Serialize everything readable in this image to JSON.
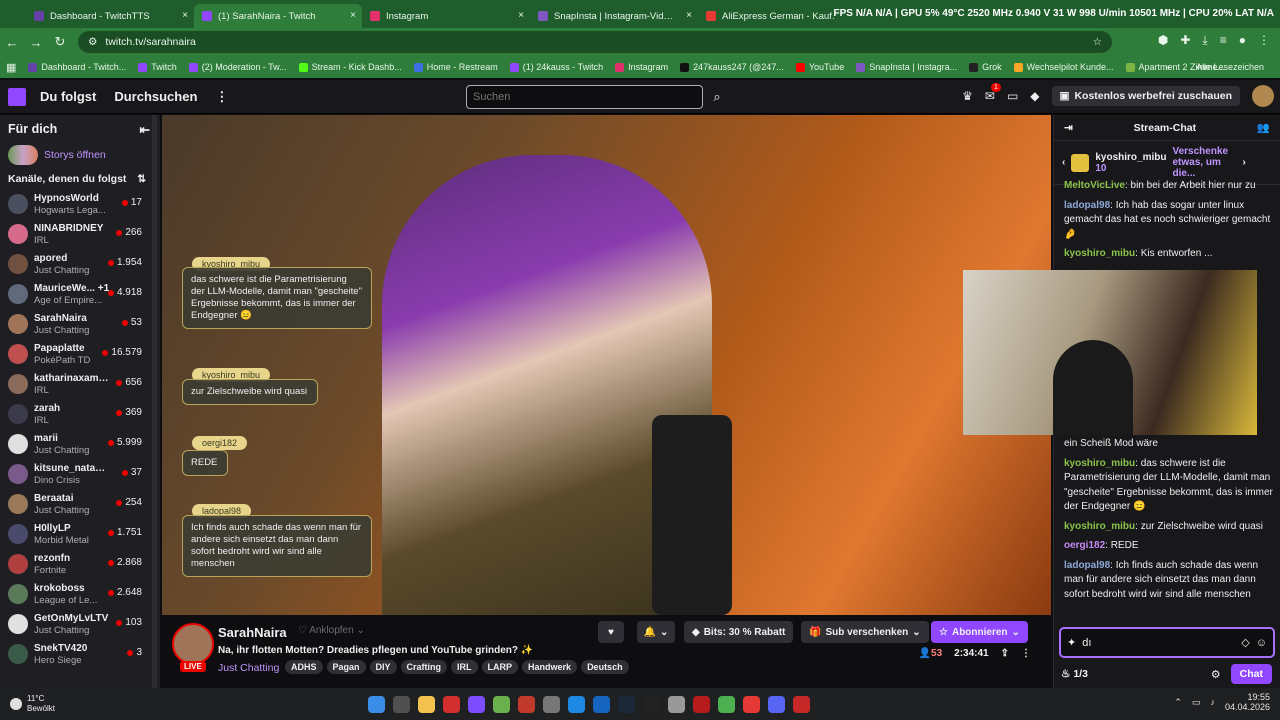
{
  "browser": {
    "tabs": [
      {
        "title": "Dashboard - TwitchTTS",
        "color": "#6441a5"
      },
      {
        "title": "(1) SarahNaira - Twitch",
        "color": "#9147ff"
      },
      {
        "title": "Instagram",
        "color": "#e1306c"
      },
      {
        "title": "SnapInsta | Instagram-Videos, F",
        "color": "#7e57c2"
      },
      {
        "title": "AliExpress German - Kaufen Si",
        "color": "#e53935"
      }
    ],
    "sysinfo": "FPS N/A N/A | GPU 5% 49°C 2520 MHz 0.940 V 31 W 998 U/min 10501 MHz | CPU 20% LAT N/A",
    "url": "twitch.tv/sarahnaira",
    "bookmarks": [
      {
        "label": "Dashboard - Twitch...",
        "color": "#6441a5"
      },
      {
        "label": "Twitch",
        "color": "#9147ff"
      },
      {
        "label": "(2) Moderation - Tw...",
        "color": "#9147ff"
      },
      {
        "label": "Stream - Kick Dashb...",
        "color": "#53fc18"
      },
      {
        "label": "Home - Restream",
        "color": "#3d6fe0"
      },
      {
        "label": "(1) 24kauss - Twitch",
        "color": "#9147ff"
      },
      {
        "label": "Instagram",
        "color": "#e1306c"
      },
      {
        "label": "247kauss247 (@247...",
        "color": "#111111"
      },
      {
        "label": "YouTube",
        "color": "#ff0000"
      },
      {
        "label": "SnapInsta | Instagra...",
        "color": "#7e57c2"
      },
      {
        "label": "Grok",
        "color": "#222222"
      },
      {
        "label": "Wechselpilot Kunde...",
        "color": "#f9a825"
      },
      {
        "label": "Apartment 2 Zimme...",
        "color": "#7cb342"
      }
    ],
    "all_bookmarks": "Alle Lesezeichen"
  },
  "twitch": {
    "nav": {
      "following": "Du folgst",
      "browse": "Durchsuchen",
      "more": "⋮",
      "search_placeholder": "Suchen",
      "promo": "Kostenlos werbefrei zuschauen",
      "notif_count": "1"
    },
    "sidebar": {
      "header": "Für dich",
      "stories": "Storys öffnen",
      "followed_header": "Kanäle, denen du folgst",
      "channels": [
        {
          "name": "HypnosWorld",
          "game": "Hogwarts Lega...",
          "viewers": "17",
          "color": "#4a5060"
        },
        {
          "name": "NINABRIDNEY",
          "game": "IRL",
          "viewers": "266",
          "color": "#d66a8a"
        },
        {
          "name": "apored",
          "game": "Just Chatting",
          "viewers": "1.954",
          "color": "#705040"
        },
        {
          "name": "MauriceWe... +1",
          "game": "Age of Empire...",
          "viewers": "4.918",
          "color": "#606a7a"
        },
        {
          "name": "SarahNaira",
          "game": "Just Chatting",
          "viewers": "53",
          "color": "#a07458"
        },
        {
          "name": "Papaplatte",
          "game": "PokéPath TD",
          "viewers": "16.579",
          "color": "#c05050"
        },
        {
          "name": "katharinaxamalia",
          "game": "IRL",
          "viewers": "656",
          "color": "#8a6a5a"
        },
        {
          "name": "zarah",
          "game": "IRL",
          "viewers": "369",
          "color": "#3a3a4a"
        },
        {
          "name": "marii",
          "game": "Just Chatting",
          "viewers": "5.999",
          "color": "#e0e0e0"
        },
        {
          "name": "kitsune_natasc...",
          "game": "Dino Crisis",
          "viewers": "37",
          "color": "#7a5a8a"
        },
        {
          "name": "Beraatai",
          "game": "Just Chatting",
          "viewers": "254",
          "color": "#9a7a5a"
        },
        {
          "name": "H0llyLP",
          "game": "Morbid Metal",
          "viewers": "1.751",
          "color": "#4a4a6a"
        },
        {
          "name": "rezonfn",
          "game": "Fortnite",
          "viewers": "2.868",
          "color": "#b04040"
        },
        {
          "name": "krokoboss",
          "game": "League of Le...",
          "viewers": "2.648",
          "color": "#5a7a5a"
        },
        {
          "name": "GetOnMyLvLTV",
          "game": "Just Chatting",
          "viewers": "103",
          "color": "#e0e0e0"
        },
        {
          "name": "SnekTV420",
          "game": "Hero Siege",
          "viewers": "3",
          "color": "#3a5a4a"
        }
      ]
    },
    "overlay": [
      {
        "user": "kyoshiro_mibu",
        "text": "das schwere ist die Parametrisierung der LLM-Modelle, damit man \"gescheite\" Ergebnisse bekommt, das is immer der Endgegner 😑"
      },
      {
        "user": "kyoshiro_mibu",
        "text": "zur Zielschweibe wird quasi"
      },
      {
        "user": "oergi182",
        "text": "REDE"
      },
      {
        "user": "ladopal98",
        "text": "Ich finds auch schade das wenn man für andere sich einsetzt das man dann sofort bedroht wird wir sind alle menschen"
      }
    ],
    "stream": {
      "name": "SarahNaira",
      "follow": "Anklopfen",
      "title": "Na, ihr flotten Motten? Dreadies pflegen und YouTube grinden? ✨",
      "category": "Just Chatting",
      "live": "LIVE",
      "tags": [
        "ADHS",
        "Pagan",
        "DIY",
        "Crafting",
        "IRL",
        "LARP",
        "Handwerk",
        "Deutsch"
      ],
      "bits": "Bits: 30 % Rabatt",
      "gift": "Sub verschenken",
      "subscribe": "Abonnieren",
      "viewers": "53",
      "uptime": "2:34:41"
    },
    "chat": {
      "header": "Stream-Chat",
      "gifter": {
        "name": "kyoshiro_mibu",
        "count": "10",
        "promo": "Verschenke etwas, um die..."
      },
      "messages": [
        {
          "user": "MeltoVicLive",
          "text": "bin bei der Arbeit hier nur zu",
          "cls": "u1"
        },
        {
          "user": "ladopal98",
          "text": "Ich hab das sogar unter linux gemacht das hat es noch schwieriger gemacht 🤌",
          "cls": "u2"
        },
        {
          "user": "kyoshiro_mibu",
          "text": "Kis entworfen ...",
          "cls": "u1"
        }
      ],
      "messages2": [
        {
          "user": "",
          "text": "ein Scheiß Mod wäre",
          "cls": "u2"
        },
        {
          "user": "kyoshiro_mibu",
          "text": "das schwere ist die Parametrisierung der LLM-Modelle, damit man \"gescheite\" Ergebnisse bekommt, das is immer der Endgegner 😑",
          "cls": "u1"
        },
        {
          "user": "kyoshiro_mibu",
          "text": "zur Zielschweibe wird quasi",
          "cls": "u1"
        },
        {
          "user": "oergi182",
          "text": "REDE",
          "cls": "u3"
        },
        {
          "user": "ladopal98",
          "text": "Ich finds auch schade das wenn man für andere sich einsetzt das man dann sofort bedroht wird wir sind alle menschen",
          "cls": "u2"
        }
      ],
      "input_value": "dı",
      "points": "1/3",
      "send": "Chat"
    }
  },
  "taskbar": {
    "weather_temp": "11°C",
    "weather_desc": "Bewölkt",
    "time": "19:55",
    "date": "04.04.2026"
  }
}
